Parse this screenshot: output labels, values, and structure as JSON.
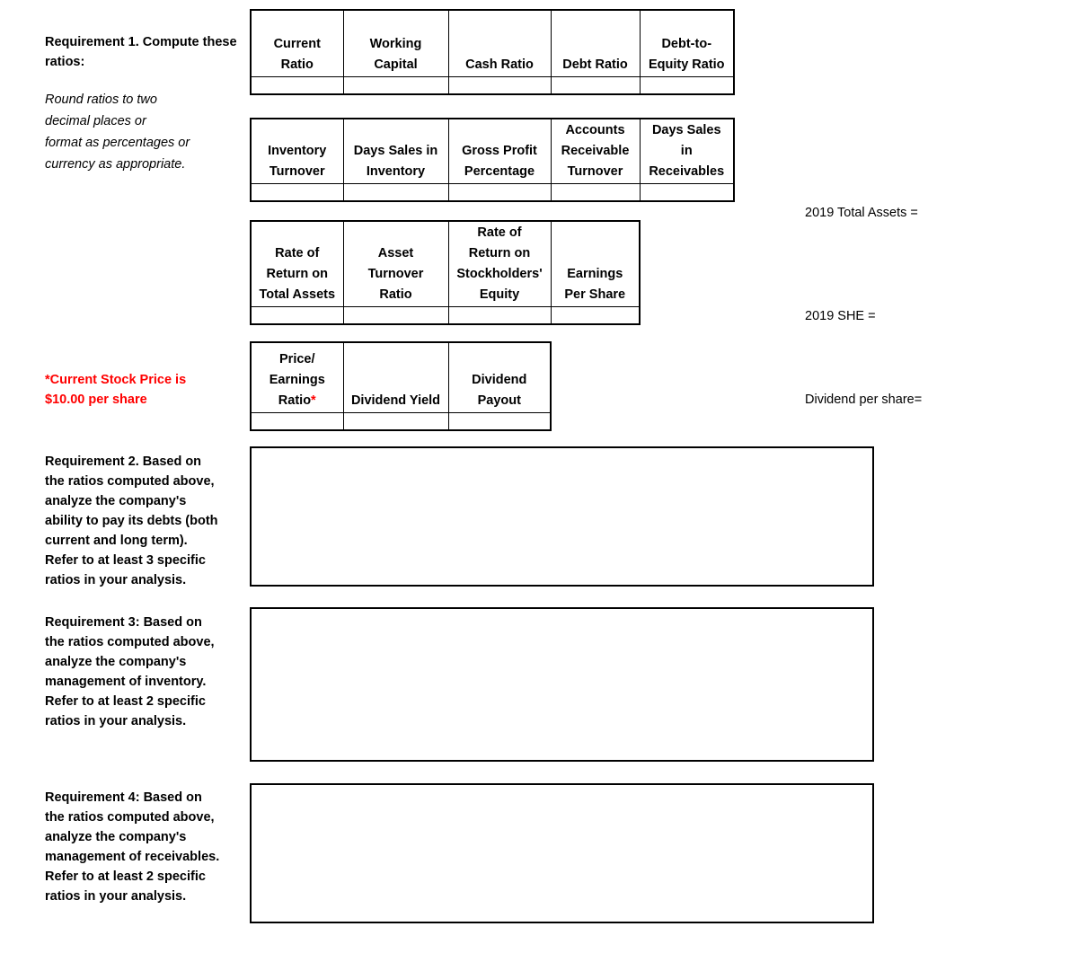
{
  "requirements": {
    "req1": {
      "heading": "Requirement 1. Compute these ratios:",
      "note_line1": "Round ratios to two",
      "note_line2": "decimal places or",
      "note_line3": "format as percentages or",
      "note_line4": "currency as appropriate."
    },
    "stock_price_note": {
      "line1": "*Current Stock Price is",
      "line2": "$10.00 per share",
      "color": "#FF0000"
    },
    "req2": {
      "text": "Requirement 2. Based on the ratios computed above, analyze the company's ability to pay its debts (both current and long term). Refer to at least 3 specific ratios in your analysis.",
      "lines": [
        "Requirement 2. Based on",
        "the ratios computed above,",
        "analyze the company's",
        "ability to pay its debts (both",
        "current and long term).",
        "Refer to at least 3 specific",
        "ratios in your analysis."
      ]
    },
    "req3": {
      "text": "Requirement 3: Based on the ratios computed above, analyze the company's management of inventory. Refer to at least 2 specific ratios in your analysis.",
      "lines": [
        "Requirement 3: Based on",
        "the ratios computed above,",
        "analyze the company's",
        "management of inventory.",
        "Refer to at least 2 specific",
        "ratios in your analysis."
      ]
    },
    "req4": {
      "text": "Requirement 4: Based on the ratios computed above, analyze the company's management of receivables. Refer to at least 2 specific ratios in your analysis.",
      "lines": [
        "Requirement 4: Based on",
        "the ratios computed above,",
        "analyze the company's",
        "management of receivables.",
        "Refer to at least 2 specific",
        "ratios in your analysis."
      ]
    }
  },
  "tables": {
    "table1": {
      "headers": [
        [
          "Current",
          "Ratio"
        ],
        [
          "Working",
          "Capital"
        ],
        [
          "Cash Ratio"
        ],
        [
          "Debt Ratio"
        ],
        [
          "Debt-to-",
          "Equity Ratio"
        ]
      ],
      "values": [
        "",
        "",
        "",
        "",
        ""
      ]
    },
    "table2": {
      "headers": [
        [
          "Inventory",
          "Turnover"
        ],
        [
          "Days Sales in",
          "Inventory"
        ],
        [
          "Gross Profit",
          "Percentage"
        ],
        [
          "Accounts",
          "Receivable",
          "Turnover"
        ],
        [
          "Days Sales",
          "in",
          "Receivables"
        ]
      ],
      "values": [
        "",
        "",
        "",
        "",
        ""
      ]
    },
    "table3": {
      "headers": [
        [
          "Rate of",
          "Return on",
          "Total Assets"
        ],
        [
          "Asset",
          "Turnover",
          "Ratio"
        ],
        [
          "Rate of",
          "Return on",
          "Stockholders'",
          "Equity"
        ],
        [
          "Earnings",
          "Per Share"
        ]
      ],
      "values": [
        "",
        "",
        "",
        ""
      ]
    },
    "table4": {
      "headers": [
        [
          "Price/",
          "Earnings",
          "Ratio*"
        ],
        [
          "Dividend Yield"
        ],
        [
          "Dividend",
          "Payout"
        ]
      ],
      "values": [
        "",
        "",
        ""
      ]
    }
  },
  "side_labels": {
    "total_assets": "2019 Total Assets =",
    "she": "2019 SHE =",
    "dividend_per_share": "Dividend per share="
  },
  "answer_boxes": {
    "box2_value": "",
    "box3_value": "",
    "box4_value": ""
  }
}
